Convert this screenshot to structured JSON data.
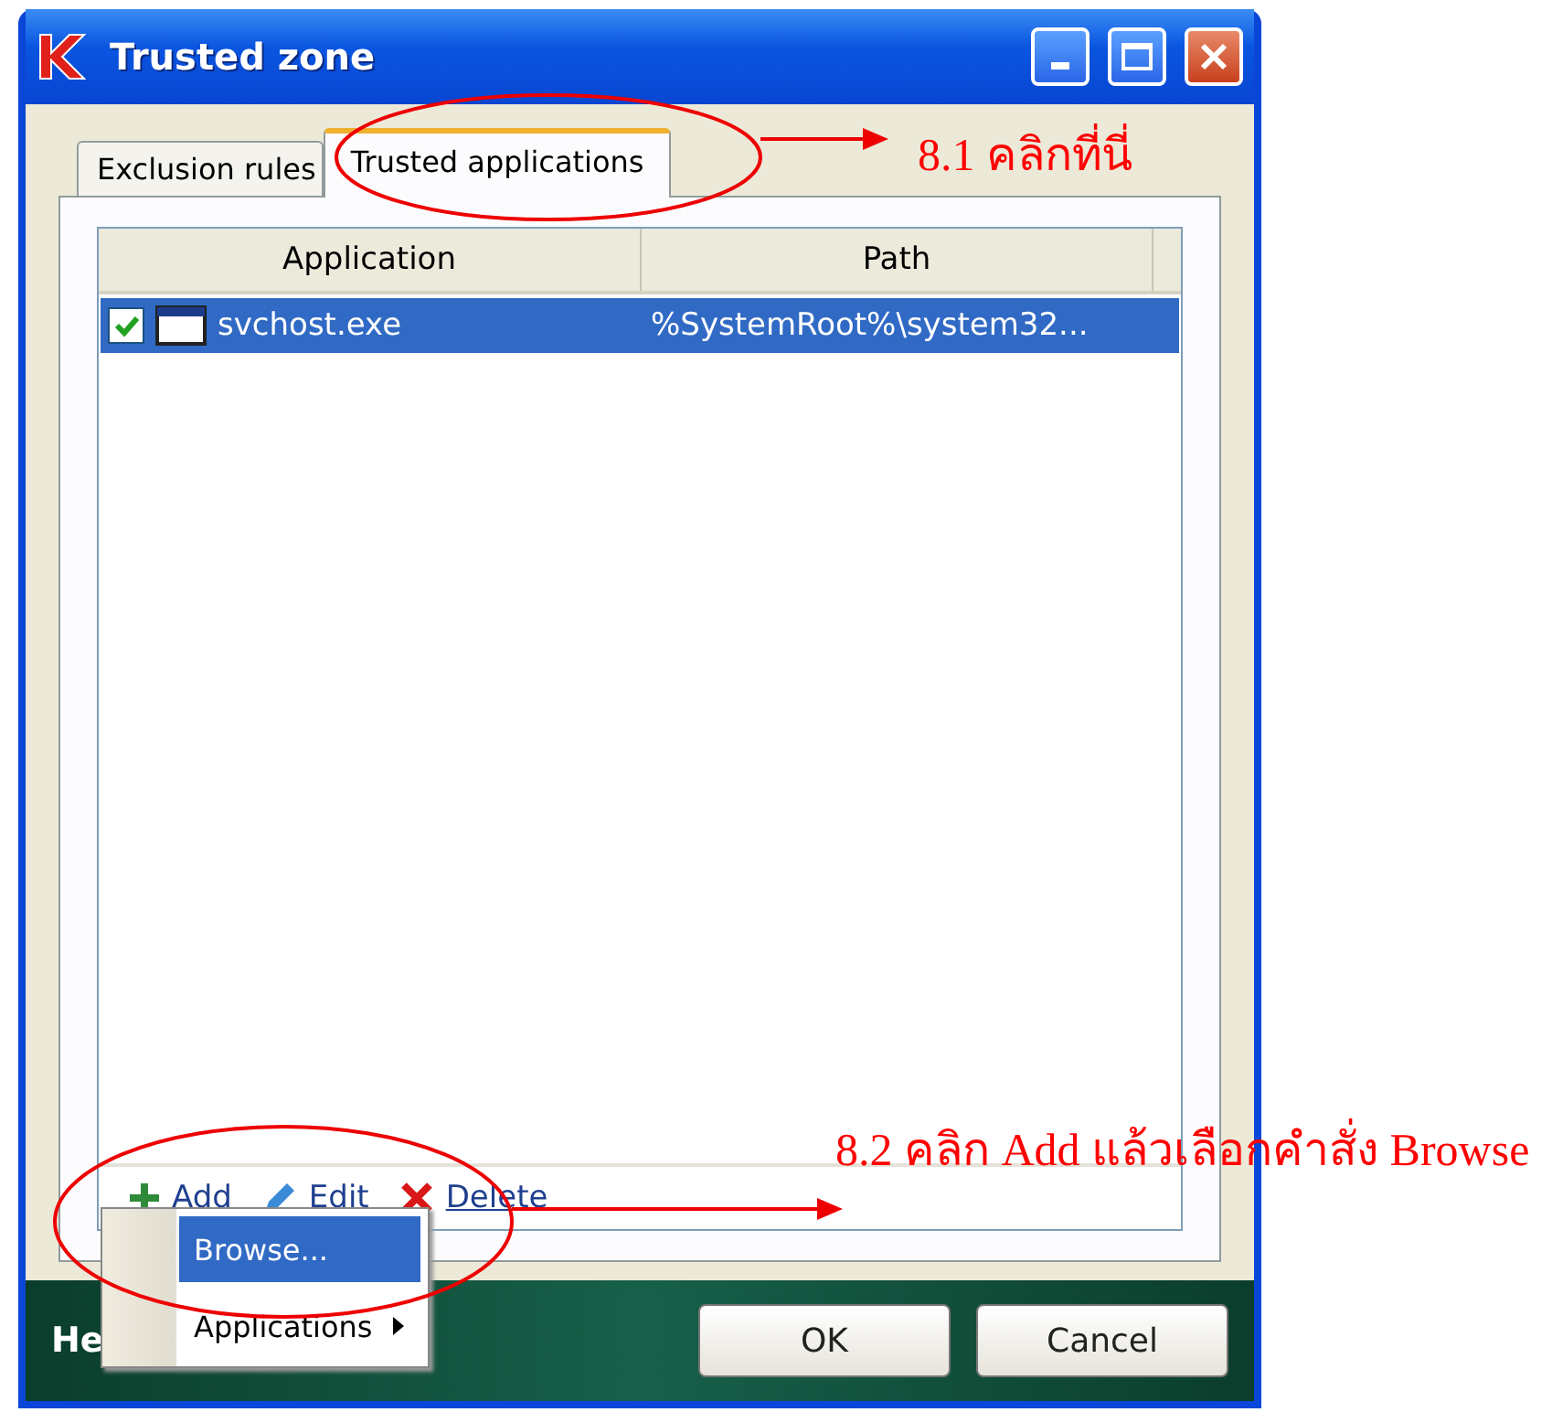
{
  "window": {
    "title": "Trusted zone"
  },
  "tabs": [
    {
      "label": "Exclusion rules",
      "selected": false
    },
    {
      "label": "Trusted applications",
      "selected": true
    }
  ],
  "table": {
    "columns": [
      "Application",
      "Path"
    ],
    "rows": [
      {
        "checked": true,
        "selected": true,
        "application": "svchost.exe",
        "path": "%SystemRoot%\\system32..."
      }
    ]
  },
  "actions": [
    {
      "kind": "add",
      "label": "Add"
    },
    {
      "kind": "edit",
      "label": "Edit"
    },
    {
      "kind": "delete",
      "label": "Delete"
    }
  ],
  "menu": [
    {
      "label": "Browse...",
      "selected": true,
      "submenu": false
    },
    {
      "label": "Applications",
      "selected": false,
      "submenu": true
    }
  ],
  "footer": {
    "help": "He",
    "buttons": [
      "OK",
      "Cancel"
    ]
  },
  "annotations": [
    {
      "text": "8.1 คลิกที่นี่"
    },
    {
      "text": "8.2 คลิก Add แล้วเลือกคำสั่ง Browse"
    }
  ]
}
